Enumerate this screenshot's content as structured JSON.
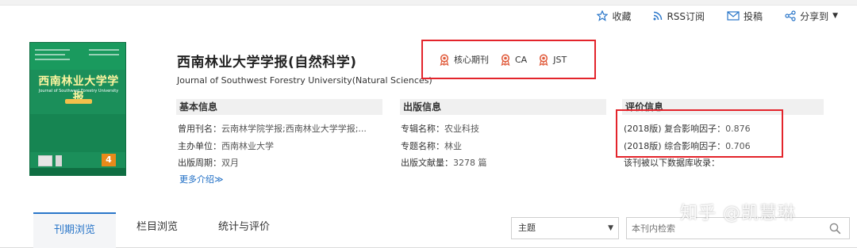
{
  "header_actions": {
    "favorite": "收藏",
    "rss": "RSS订阅",
    "submit": "投稿",
    "share": "分享到"
  },
  "cover": {
    "title": "西南林业大学学报",
    "subtitle": "Journal of Southwest Forestry University",
    "issue": "4"
  },
  "journal": {
    "title": "西南林业大学学报(自然科学)",
    "en_title": "Journal of Southwest Forestry University(Natural Sciences)"
  },
  "badges": [
    "核心期刊",
    "CA",
    "JST"
  ],
  "basic_info": {
    "heading": "基本信息",
    "rows": [
      {
        "label": "曾用刊名：",
        "value": "云南林学院学报;西南林业大学学报;..."
      },
      {
        "label": "主办单位：",
        "value": "西南林业大学"
      },
      {
        "label": "出版周期：",
        "value": "双月"
      }
    ],
    "more": "更多介绍≫"
  },
  "publish_info": {
    "heading": "出版信息",
    "rows": [
      {
        "label": "专辑名称：",
        "value": "农业科技"
      },
      {
        "label": "专题名称：",
        "value": "林业"
      },
      {
        "label": "出版文献量：",
        "value": "3278 篇"
      }
    ]
  },
  "eval_info": {
    "heading": "评价信息",
    "rows": [
      {
        "label": "(2018版) 复合影响因子：",
        "value": "0.876"
      },
      {
        "label": "(2018版) 综合影响因子：",
        "value": "0.706"
      },
      {
        "label": "该刊被以下数据库收录：",
        "value": ""
      }
    ]
  },
  "tabs": {
    "active": "刊期浏览",
    "column": "栏目浏览",
    "stats": "统计与评价"
  },
  "search": {
    "select_value": "主题",
    "placeholder": "本刊内检索"
  },
  "watermark": "知乎 @凯慧琳",
  "colors": {
    "accent_blue": "#2a76c9",
    "highlight_red": "#e3242b",
    "cover_green": "#1b8f5a"
  }
}
